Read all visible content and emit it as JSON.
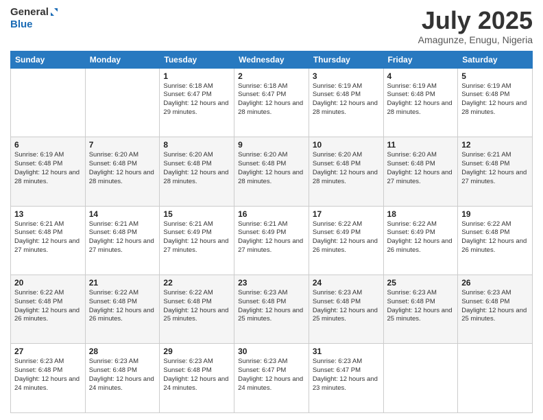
{
  "header": {
    "logo_line1": "General",
    "logo_line2": "Blue",
    "title": "July 2025",
    "location": "Amagunze, Enugu, Nigeria"
  },
  "days_of_week": [
    "Sunday",
    "Monday",
    "Tuesday",
    "Wednesday",
    "Thursday",
    "Friday",
    "Saturday"
  ],
  "weeks": [
    [
      {
        "num": "",
        "info": ""
      },
      {
        "num": "",
        "info": ""
      },
      {
        "num": "1",
        "info": "Sunrise: 6:18 AM\nSunset: 6:47 PM\nDaylight: 12 hours and 29 minutes."
      },
      {
        "num": "2",
        "info": "Sunrise: 6:18 AM\nSunset: 6:47 PM\nDaylight: 12 hours and 28 minutes."
      },
      {
        "num": "3",
        "info": "Sunrise: 6:19 AM\nSunset: 6:48 PM\nDaylight: 12 hours and 28 minutes."
      },
      {
        "num": "4",
        "info": "Sunrise: 6:19 AM\nSunset: 6:48 PM\nDaylight: 12 hours and 28 minutes."
      },
      {
        "num": "5",
        "info": "Sunrise: 6:19 AM\nSunset: 6:48 PM\nDaylight: 12 hours and 28 minutes."
      }
    ],
    [
      {
        "num": "6",
        "info": "Sunrise: 6:19 AM\nSunset: 6:48 PM\nDaylight: 12 hours and 28 minutes."
      },
      {
        "num": "7",
        "info": "Sunrise: 6:20 AM\nSunset: 6:48 PM\nDaylight: 12 hours and 28 minutes."
      },
      {
        "num": "8",
        "info": "Sunrise: 6:20 AM\nSunset: 6:48 PM\nDaylight: 12 hours and 28 minutes."
      },
      {
        "num": "9",
        "info": "Sunrise: 6:20 AM\nSunset: 6:48 PM\nDaylight: 12 hours and 28 minutes."
      },
      {
        "num": "10",
        "info": "Sunrise: 6:20 AM\nSunset: 6:48 PM\nDaylight: 12 hours and 28 minutes."
      },
      {
        "num": "11",
        "info": "Sunrise: 6:20 AM\nSunset: 6:48 PM\nDaylight: 12 hours and 27 minutes."
      },
      {
        "num": "12",
        "info": "Sunrise: 6:21 AM\nSunset: 6:48 PM\nDaylight: 12 hours and 27 minutes."
      }
    ],
    [
      {
        "num": "13",
        "info": "Sunrise: 6:21 AM\nSunset: 6:48 PM\nDaylight: 12 hours and 27 minutes."
      },
      {
        "num": "14",
        "info": "Sunrise: 6:21 AM\nSunset: 6:48 PM\nDaylight: 12 hours and 27 minutes."
      },
      {
        "num": "15",
        "info": "Sunrise: 6:21 AM\nSunset: 6:49 PM\nDaylight: 12 hours and 27 minutes."
      },
      {
        "num": "16",
        "info": "Sunrise: 6:21 AM\nSunset: 6:49 PM\nDaylight: 12 hours and 27 minutes."
      },
      {
        "num": "17",
        "info": "Sunrise: 6:22 AM\nSunset: 6:49 PM\nDaylight: 12 hours and 26 minutes."
      },
      {
        "num": "18",
        "info": "Sunrise: 6:22 AM\nSunset: 6:49 PM\nDaylight: 12 hours and 26 minutes."
      },
      {
        "num": "19",
        "info": "Sunrise: 6:22 AM\nSunset: 6:48 PM\nDaylight: 12 hours and 26 minutes."
      }
    ],
    [
      {
        "num": "20",
        "info": "Sunrise: 6:22 AM\nSunset: 6:48 PM\nDaylight: 12 hours and 26 minutes."
      },
      {
        "num": "21",
        "info": "Sunrise: 6:22 AM\nSunset: 6:48 PM\nDaylight: 12 hours and 26 minutes."
      },
      {
        "num": "22",
        "info": "Sunrise: 6:22 AM\nSunset: 6:48 PM\nDaylight: 12 hours and 25 minutes."
      },
      {
        "num": "23",
        "info": "Sunrise: 6:23 AM\nSunset: 6:48 PM\nDaylight: 12 hours and 25 minutes."
      },
      {
        "num": "24",
        "info": "Sunrise: 6:23 AM\nSunset: 6:48 PM\nDaylight: 12 hours and 25 minutes."
      },
      {
        "num": "25",
        "info": "Sunrise: 6:23 AM\nSunset: 6:48 PM\nDaylight: 12 hours and 25 minutes."
      },
      {
        "num": "26",
        "info": "Sunrise: 6:23 AM\nSunset: 6:48 PM\nDaylight: 12 hours and 25 minutes."
      }
    ],
    [
      {
        "num": "27",
        "info": "Sunrise: 6:23 AM\nSunset: 6:48 PM\nDaylight: 12 hours and 24 minutes."
      },
      {
        "num": "28",
        "info": "Sunrise: 6:23 AM\nSunset: 6:48 PM\nDaylight: 12 hours and 24 minutes."
      },
      {
        "num": "29",
        "info": "Sunrise: 6:23 AM\nSunset: 6:48 PM\nDaylight: 12 hours and 24 minutes."
      },
      {
        "num": "30",
        "info": "Sunrise: 6:23 AM\nSunset: 6:47 PM\nDaylight: 12 hours and 24 minutes."
      },
      {
        "num": "31",
        "info": "Sunrise: 6:23 AM\nSunset: 6:47 PM\nDaylight: 12 hours and 23 minutes."
      },
      {
        "num": "",
        "info": ""
      },
      {
        "num": "",
        "info": ""
      }
    ]
  ]
}
